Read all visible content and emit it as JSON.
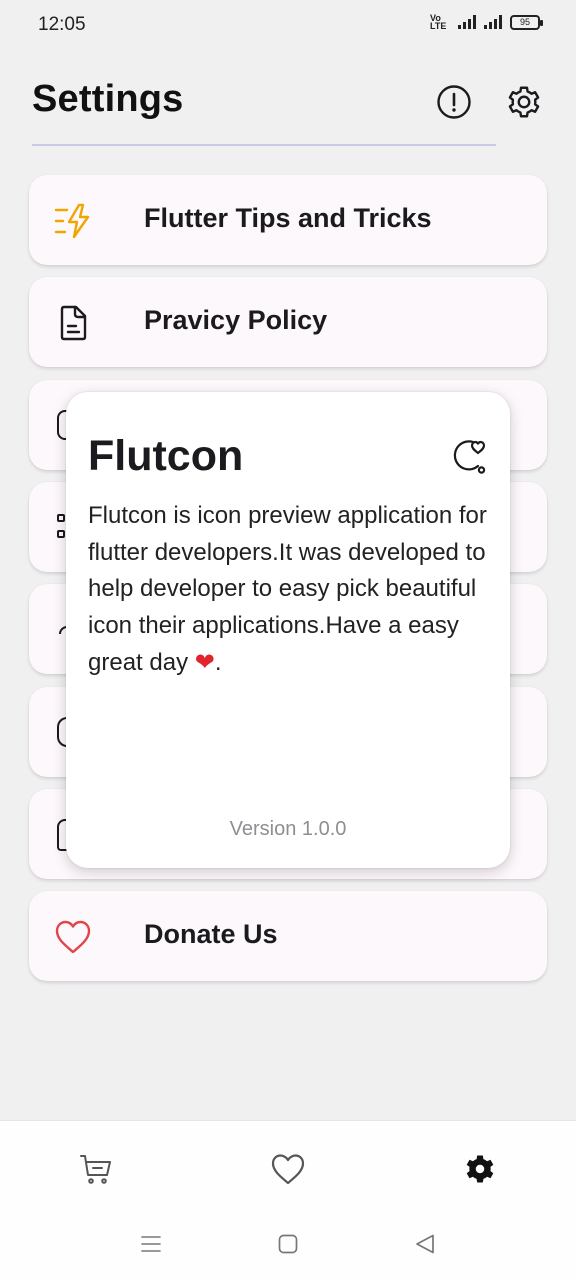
{
  "status_bar": {
    "time": "12:05",
    "network_label": "Vo LTE",
    "battery": "95"
  },
  "header": {
    "title": "Settings"
  },
  "settings_items": [
    {
      "label": "Flutter Tips and Tricks",
      "icon": "lightning-list-icon",
      "color": "#f0a500"
    },
    {
      "label": "Pravicy Policy",
      "icon": "document-icon",
      "color": "#1b1b1f"
    },
    {
      "label": "Donate Us",
      "icon": "heart-icon",
      "color": "#e0454a"
    }
  ],
  "dialog": {
    "title": "Flutcon",
    "body": "Flutcon is icon preview application for flutter developers.It was developed to help developer to easy pick beautiful icon their applications.Have a easy great day ",
    "body_end": ".",
    "version": "Version 1.0.0"
  },
  "bottom_nav": [
    {
      "name": "cart",
      "icon": "cart-icon",
      "active": false
    },
    {
      "name": "favorites",
      "icon": "heart-icon",
      "active": false
    },
    {
      "name": "settings",
      "icon": "gear-icon",
      "active": true
    }
  ],
  "colors": {
    "background": "#f0f0f1",
    "card": "#fdf8fc",
    "accent_orange": "#f0a500",
    "heart_red": "#e0454a",
    "divider": "#c9cbe4"
  }
}
